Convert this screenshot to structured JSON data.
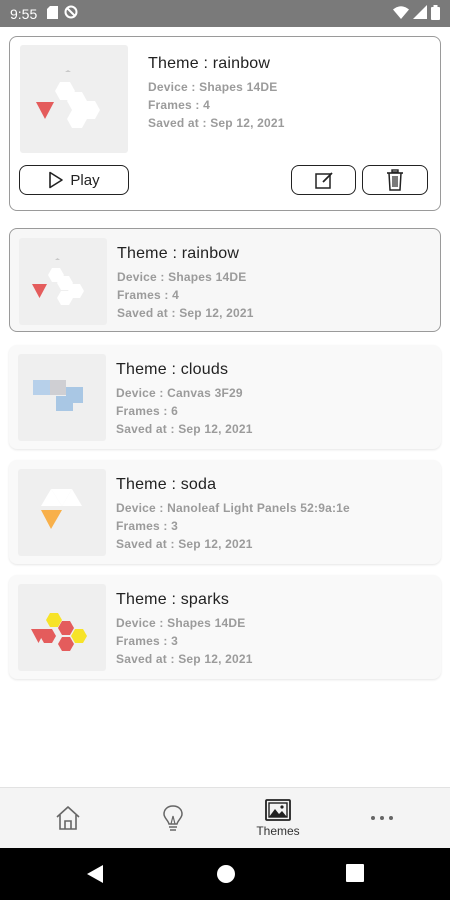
{
  "status_bar": {
    "time": "9:55",
    "icons_left": [
      "sd-card-icon",
      "no-disturb-icon"
    ],
    "icons_right": [
      "wifi-icon",
      "signal-icon",
      "battery-icon"
    ]
  },
  "detail": {
    "title": "Theme : rainbow",
    "device": "Device : Shapes 14DE",
    "frames": "Frames : 4",
    "saved": "Saved at : Sep 12, 2021",
    "play_label": "Play"
  },
  "themes": [
    {
      "title": "Theme : rainbow",
      "device": "Device : Shapes 14DE",
      "frames": "Frames : 4",
      "saved": "Saved at : Sep 12, 2021",
      "selected": true
    },
    {
      "title": "Theme : clouds",
      "device": "Device : Canvas 3F29",
      "frames": "Frames : 6",
      "saved": "Saved at : Sep 12, 2021",
      "selected": false
    },
    {
      "title": "Theme : soda",
      "device": "Device : Nanoleaf Light Panels 52:9a:1e",
      "frames": "Frames : 3",
      "saved": "Saved at : Sep 12, 2021",
      "selected": false
    },
    {
      "title": "Theme : sparks",
      "device": "Device : Shapes 14DE",
      "frames": "Frames : 3",
      "saved": "Saved at : Sep 12, 2021",
      "selected": false
    }
  ],
  "bottom_nav": {
    "items": [
      {
        "icon": "home-icon",
        "label": ""
      },
      {
        "icon": "lightbulb-icon",
        "label": ""
      },
      {
        "icon": "image-gallery-icon",
        "label": "Themes"
      },
      {
        "icon": "more-horizontal-icon",
        "label": ""
      }
    ]
  },
  "colors": {
    "status_bar": "#7a7a7a",
    "card_border": "#9a9a9a",
    "meta_text": "#9b9b9b",
    "red": "#e45c5c",
    "yellow": "#f7e328",
    "orange": "#f8b04a",
    "blue_light": "#b7d0ea",
    "blue_mid": "#a9c7e4"
  }
}
